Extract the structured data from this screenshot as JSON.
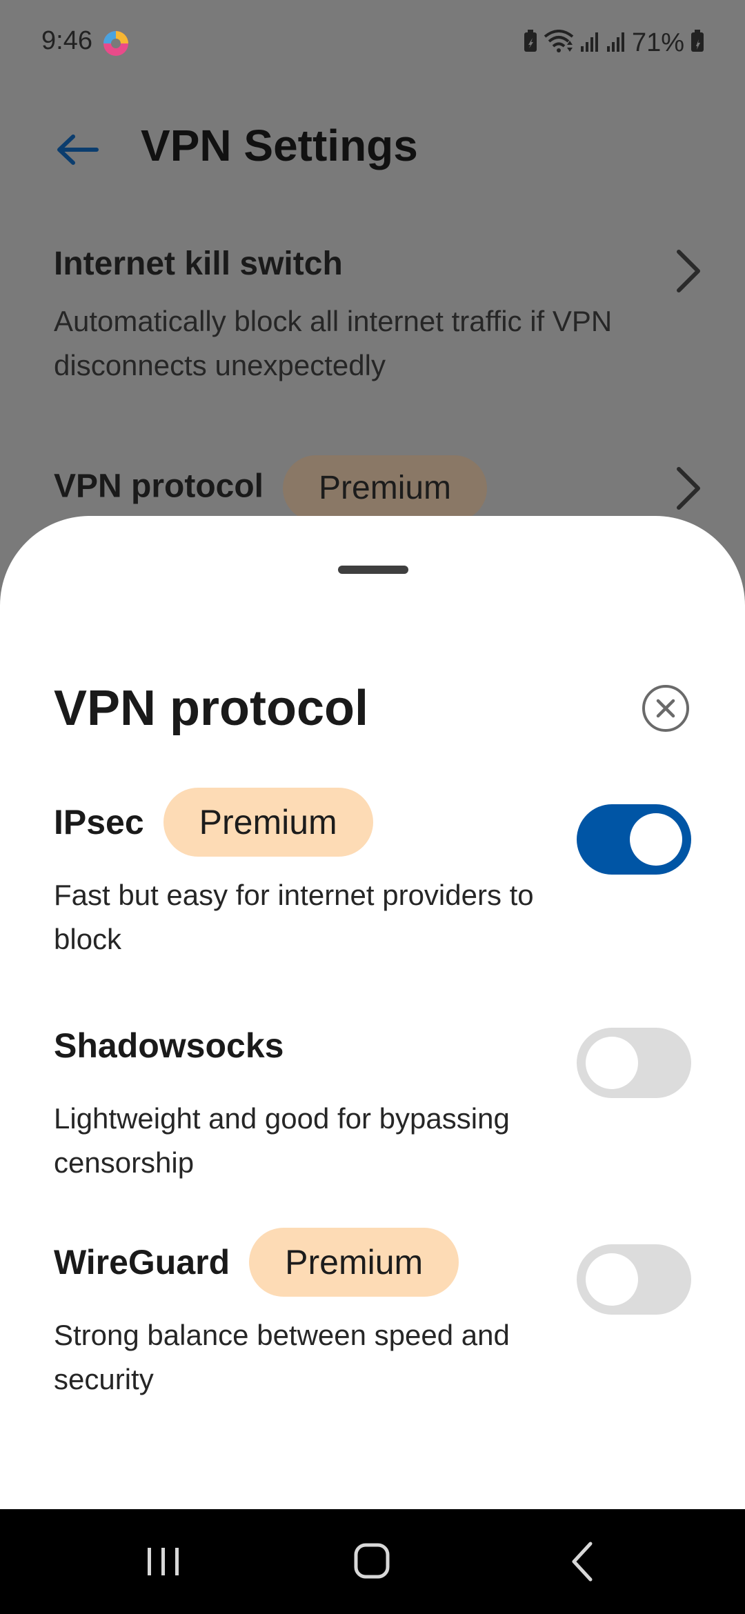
{
  "status_bar": {
    "time": "9:46",
    "battery": "71%",
    "icons": [
      "app-notification-icon",
      "battery-saver-icon",
      "wifi-icon",
      "signal-icon",
      "signal-icon",
      "battery-icon"
    ]
  },
  "background_page": {
    "title": "VPN Settings",
    "back_icon": "arrow-left-icon",
    "items": [
      {
        "title": "Internet kill switch",
        "description": "Automatically block all internet traffic if VPN disconnects unexpectedly"
      },
      {
        "title": "VPN protocol",
        "badge": "Premium"
      }
    ]
  },
  "sheet": {
    "title": "VPN protocol",
    "close_icon": "close-circle-icon",
    "options": [
      {
        "name": "IPsec",
        "badge": "Premium",
        "description": "Fast but easy for internet providers to block",
        "enabled": true
      },
      {
        "name": "Shadowsocks",
        "description": "Lightweight and good for bypassing censorship",
        "enabled": false
      },
      {
        "name": "WireGuard",
        "badge": "Premium",
        "description": "Strong balance between speed and security",
        "enabled": false
      }
    ]
  },
  "nav_bar": {
    "buttons": [
      "recent-apps-icon",
      "home-icon",
      "back-icon"
    ]
  },
  "colors": {
    "scrim_background": "#7a7a7a",
    "toggle_on": "#0055a5",
    "toggle_off": "#dcdcdc",
    "premium_badge": "#fddbb5"
  }
}
